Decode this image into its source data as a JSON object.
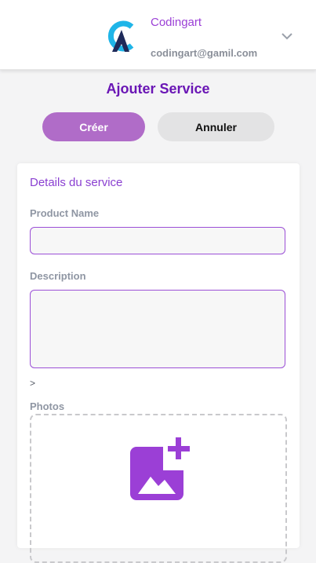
{
  "header": {
    "brand_name": "Codingart",
    "email": "codingart@gamil.com",
    "logo_icon": "codingart-logo-icon",
    "menu_icon": "chevron-down-icon"
  },
  "page": {
    "title": "Ajouter Service"
  },
  "actions": {
    "create_label": "Créer",
    "cancel_label": "Annuler"
  },
  "form": {
    "section_title": "Details du service",
    "product_name_label": "Product Name",
    "product_name_value": "",
    "description_label": "Description",
    "description_value": "",
    "marker_text": ">",
    "photos_label": "Photos",
    "add_photo_icon": "add-photo-icon"
  },
  "colors": {
    "accent": "#9b3fd6",
    "title": "#6a16b5",
    "create_button": "#b06cc8",
    "cancel_button": "#e3e3e4",
    "logo_cyan": "#1fb5e8",
    "logo_navy": "#1e2a5a"
  }
}
